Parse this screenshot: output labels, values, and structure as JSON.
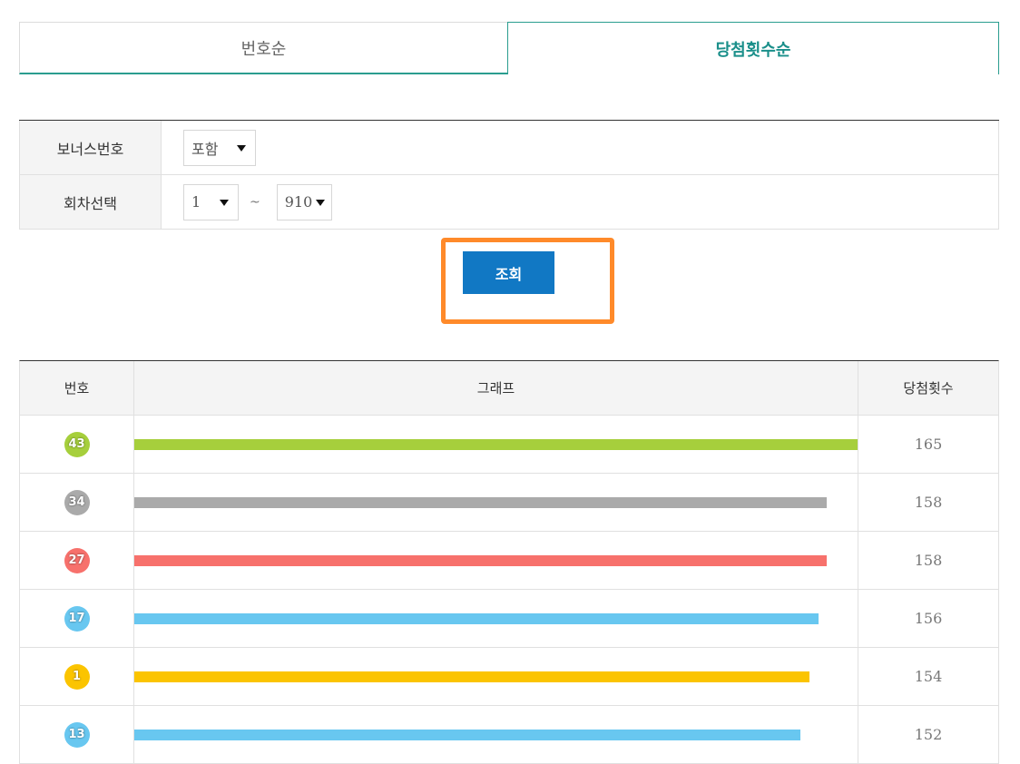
{
  "tabs": [
    {
      "label": "번호순",
      "active": false
    },
    {
      "label": "당첨횟수순",
      "active": true
    }
  ],
  "filter": {
    "bonus_label": "보너스번호",
    "bonus_value": "포함",
    "round_label": "회차선택",
    "round_from": "1",
    "round_sep": "~",
    "round_to": "910"
  },
  "search_label": "조회",
  "table": {
    "headers": [
      "번호",
      "그래프",
      "당첨횟수"
    ],
    "max_count": 165,
    "rows": [
      {
        "number": "43",
        "count": 165,
        "count_label": "165",
        "color": "#a6cf3c"
      },
      {
        "number": "34",
        "count": 158,
        "count_label": "158",
        "color": "#aaaaaa"
      },
      {
        "number": "27",
        "count": 158,
        "count_label": "158",
        "color": "#f7716c"
      },
      {
        "number": "17",
        "count": 156,
        "count_label": "156",
        "color": "#68c7f0"
      },
      {
        "number": "1",
        "count": 154,
        "count_label": "154",
        "color": "#fbc400"
      },
      {
        "number": "13",
        "count": 152,
        "count_label": "152",
        "color": "#68c7f0"
      }
    ]
  },
  "colors": {
    "accent": "#2a9d8f",
    "button": "#1178c4",
    "highlight": "#ff8a2a"
  }
}
